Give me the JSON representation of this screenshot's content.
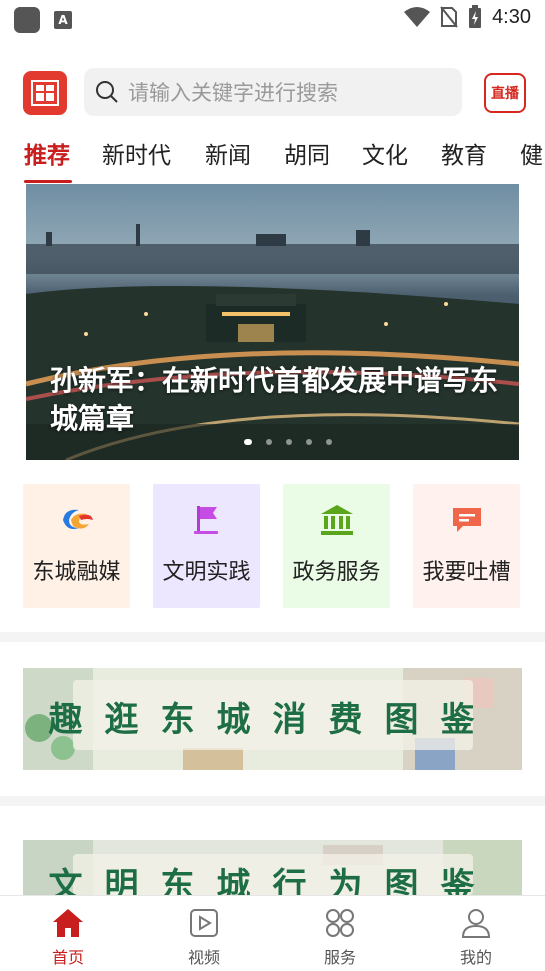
{
  "status_bar": {
    "time": "4:30",
    "app_icon_letter": "A"
  },
  "header": {
    "search_placeholder": "请输入关键字进行搜索",
    "live_label": "直播"
  },
  "tabs": [
    "推荐",
    "新时代",
    "新闻",
    "胡同",
    "文化",
    "教育",
    "健"
  ],
  "active_tab": "推荐",
  "banner": {
    "title": "孙新军：在新时代首都发展中谱写东城篇章",
    "page_count": 5,
    "current_page": 1
  },
  "services": [
    {
      "label": "东城融媒",
      "icon": "dongcheng-media-icon",
      "bg": "#fff1e6"
    },
    {
      "label": "文明实践",
      "icon": "flag-icon",
      "bg": "#ece6ff"
    },
    {
      "label": "政务服务",
      "icon": "government-building-icon",
      "bg": "#eafbe6"
    },
    {
      "label": "我要吐槽",
      "icon": "chat-bubble-icon",
      "bg": "#fff2ee"
    }
  ],
  "promos": [
    {
      "text": "趣逛东城消费图鉴"
    },
    {
      "text": "文明东城行为图鉴"
    }
  ],
  "bottom_nav": [
    {
      "label": "首页",
      "icon": "home-icon",
      "active": true
    },
    {
      "label": "视频",
      "icon": "video-play-icon",
      "active": false
    },
    {
      "label": "服务",
      "icon": "services-grid-icon",
      "active": false
    },
    {
      "label": "我的",
      "icon": "user-profile-icon",
      "active": false
    }
  ],
  "colors": {
    "accent": "#c81e1e",
    "promo_text": "#1e6e45"
  }
}
